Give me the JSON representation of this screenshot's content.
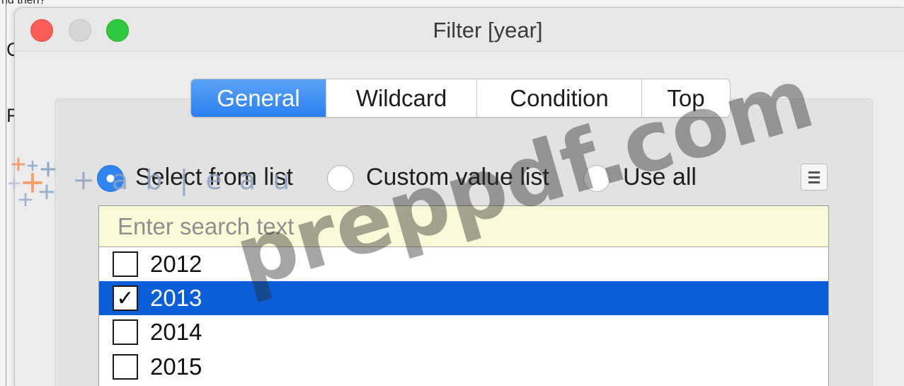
{
  "window": {
    "title": "Filter [year]"
  },
  "tabs": [
    "General",
    "Wildcard",
    "Condition",
    "Top"
  ],
  "radios": {
    "select_from_list": "Select from list",
    "custom_value_list": "Custom value list",
    "use_all": "Use all",
    "selected": "select_from_list"
  },
  "search": {
    "placeholder": "Enter search text"
  },
  "list": {
    "items": [
      {
        "label": "2012",
        "checked": false,
        "selected": false
      },
      {
        "label": "2013",
        "checked": true,
        "selected": true
      },
      {
        "label": "2014",
        "checked": false,
        "selected": false
      },
      {
        "label": "2015",
        "checked": false,
        "selected": false
      }
    ]
  },
  "overlay": {
    "watermark": "preppdf.com",
    "logo_text": "+ a b | e a u"
  },
  "background": {
    "fragments": [
      "C",
      "F"
    ],
    "top_fragment": "nd then?"
  },
  "colors": {
    "accent": "#2a7ff0",
    "selection": "#0a5fd8",
    "search_bg": "#fafad9"
  }
}
